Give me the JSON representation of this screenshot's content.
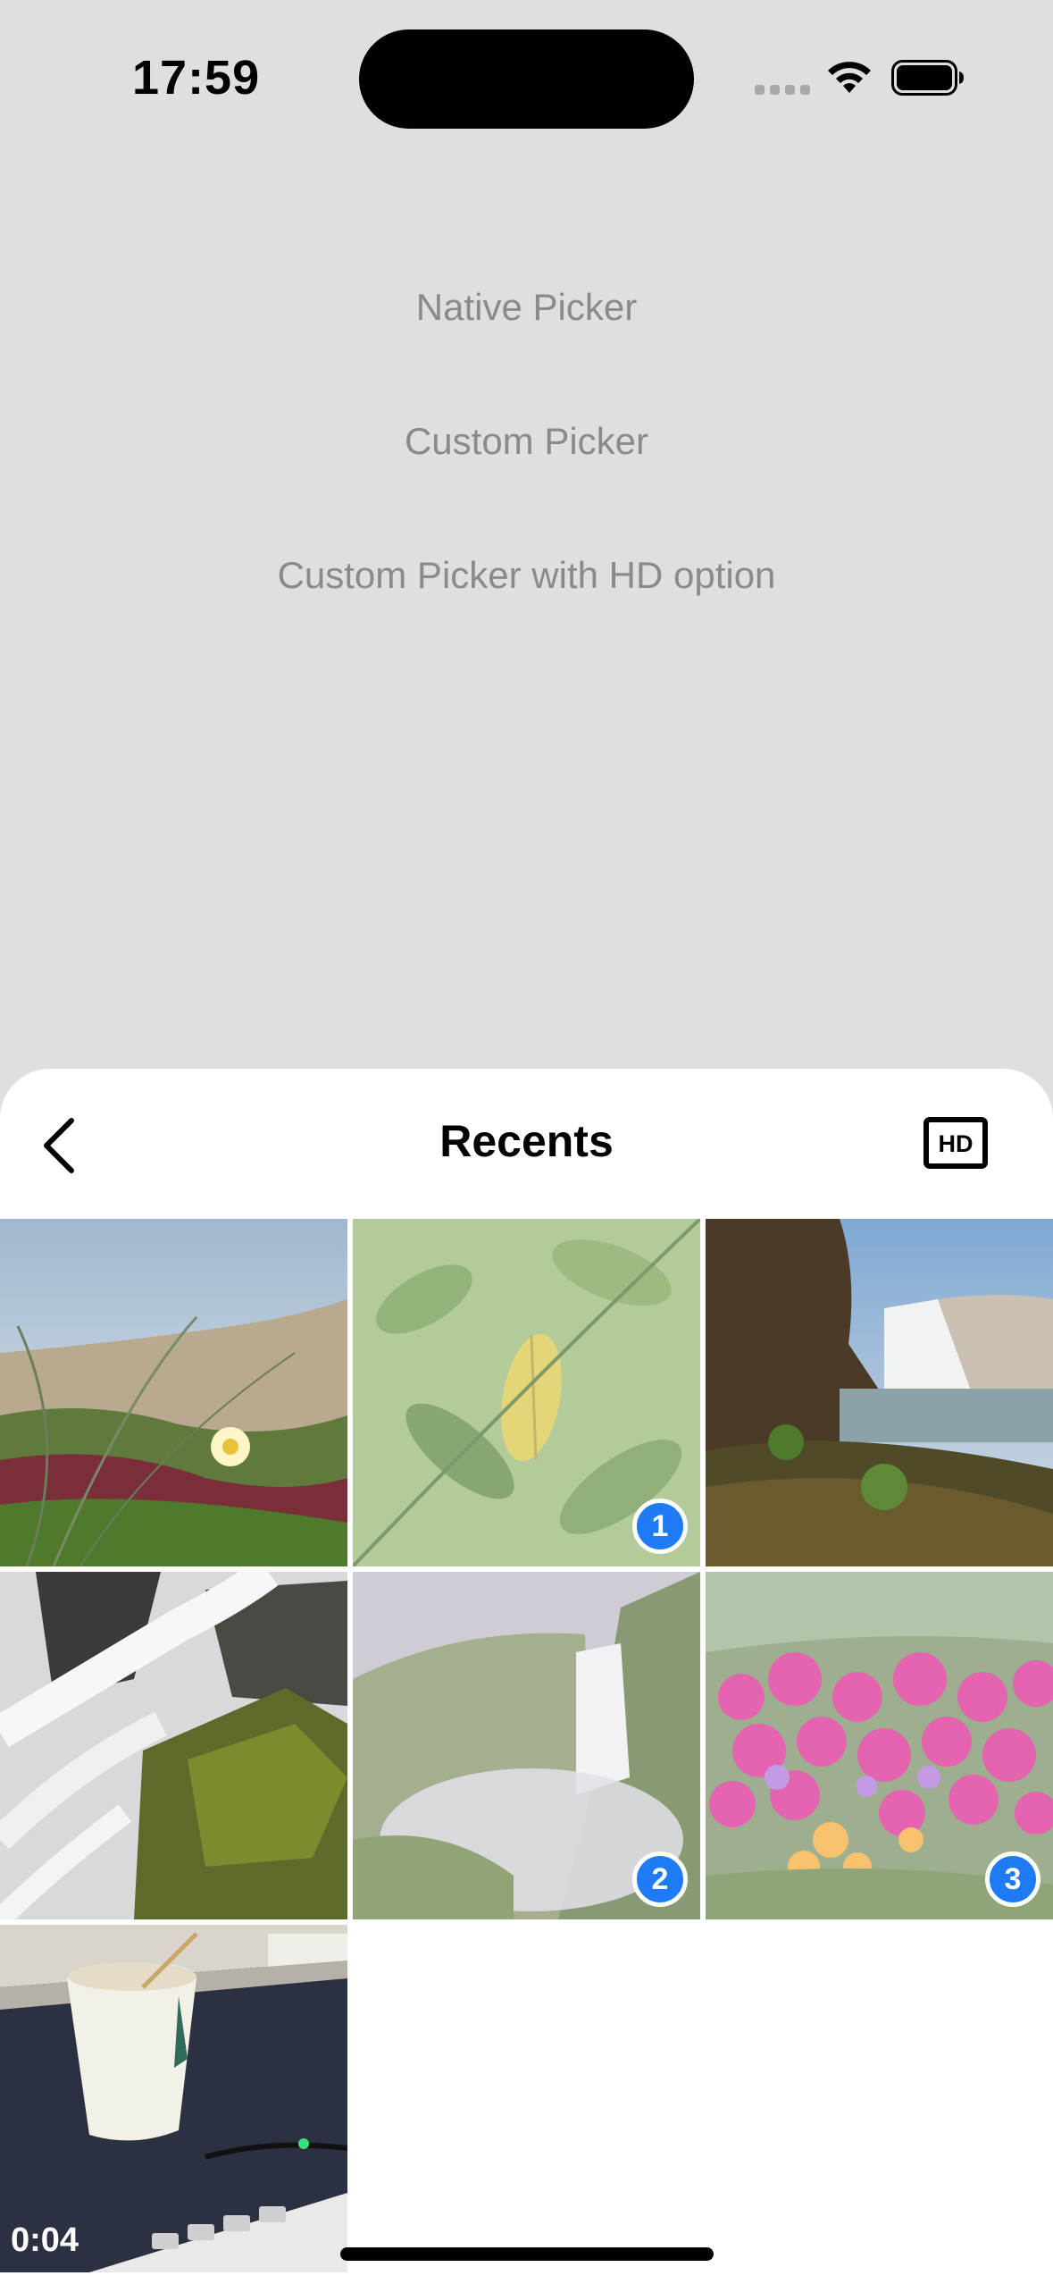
{
  "status_bar": {
    "time": "17:59",
    "signal_icon": "cellular-signal-icon",
    "wifi_icon": "wifi-icon",
    "battery_icon": "battery-icon"
  },
  "menu": {
    "items": [
      {
        "label": "Native Picker"
      },
      {
        "label": "Custom Picker"
      },
      {
        "label": "Custom Picker with HD option"
      }
    ]
  },
  "sheet": {
    "title": "Recents",
    "back_icon": "chevron-left-icon",
    "hd_icon": "hd-icon",
    "hd_label": "HD"
  },
  "photos": [
    {
      "subject": "beach-grass-flower",
      "selected": false,
      "order": ""
    },
    {
      "subject": "green-leaves",
      "selected": true,
      "order": "1"
    },
    {
      "subject": "waterfall-cliff",
      "selected": false,
      "order": ""
    },
    {
      "subject": "waterfall-rocks",
      "selected": false,
      "order": ""
    },
    {
      "subject": "misty-waterfall",
      "selected": true,
      "order": "2"
    },
    {
      "subject": "pink-flowers",
      "selected": true,
      "order": "3"
    },
    {
      "subject": "coffee-cup-video",
      "selected": false,
      "order": "",
      "duration": "0:04"
    }
  ],
  "colors": {
    "backdrop": "#dfdfdf",
    "selection_badge": "#1d7bf5",
    "sheet_background": "#ffffff"
  }
}
